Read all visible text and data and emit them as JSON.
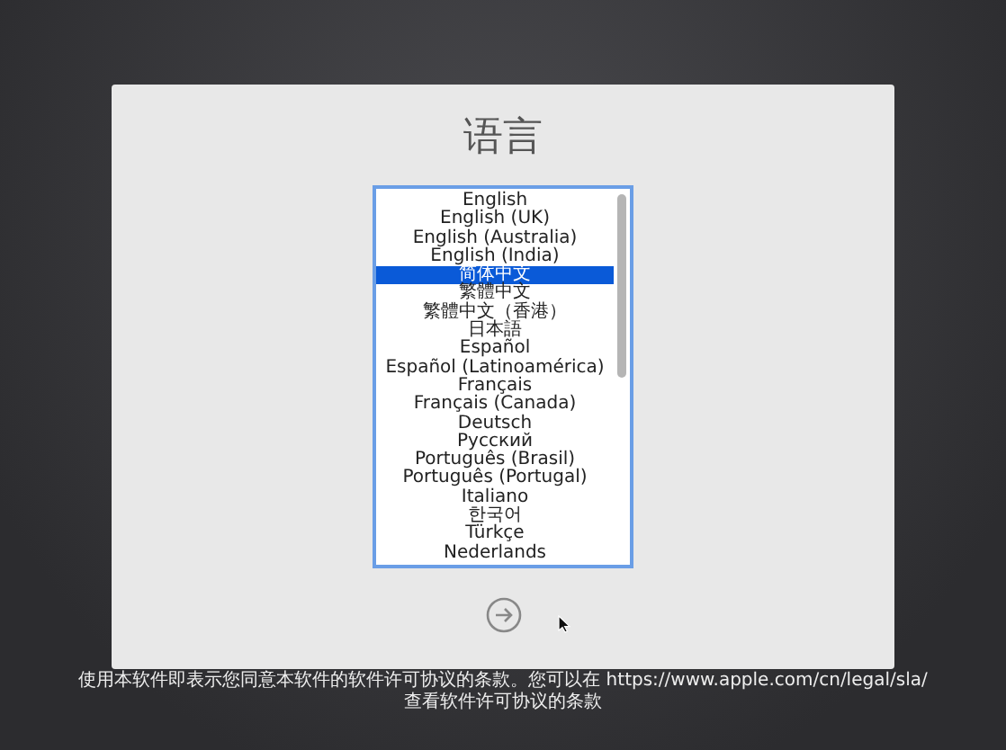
{
  "title": "语言",
  "languages": [
    {
      "label": "English",
      "selected": false
    },
    {
      "label": "English (UK)",
      "selected": false
    },
    {
      "label": "English (Australia)",
      "selected": false
    },
    {
      "label": "English (India)",
      "selected": false
    },
    {
      "label": "简体中文",
      "selected": true
    },
    {
      "label": "繁體中文",
      "selected": false
    },
    {
      "label": "繁體中文（香港）",
      "selected": false
    },
    {
      "label": "日本語",
      "selected": false
    },
    {
      "label": "Español",
      "selected": false
    },
    {
      "label": "Español (Latinoamérica)",
      "selected": false
    },
    {
      "label": "Français",
      "selected": false
    },
    {
      "label": "Français (Canada)",
      "selected": false
    },
    {
      "label": "Deutsch",
      "selected": false
    },
    {
      "label": "Русский",
      "selected": false
    },
    {
      "label": "Português (Brasil)",
      "selected": false
    },
    {
      "label": "Português (Portugal)",
      "selected": false
    },
    {
      "label": "Italiano",
      "selected": false
    },
    {
      "label": "한국어",
      "selected": false
    },
    {
      "label": "Türkçe",
      "selected": false
    },
    {
      "label": "Nederlands",
      "selected": false
    }
  ],
  "footer": [
    "使用本软件即表示您同意本软件的软件许可协议的条款。您可以在 https://www.apple.com/cn/legal/sla/",
    "查看软件许可协议的条款"
  ]
}
